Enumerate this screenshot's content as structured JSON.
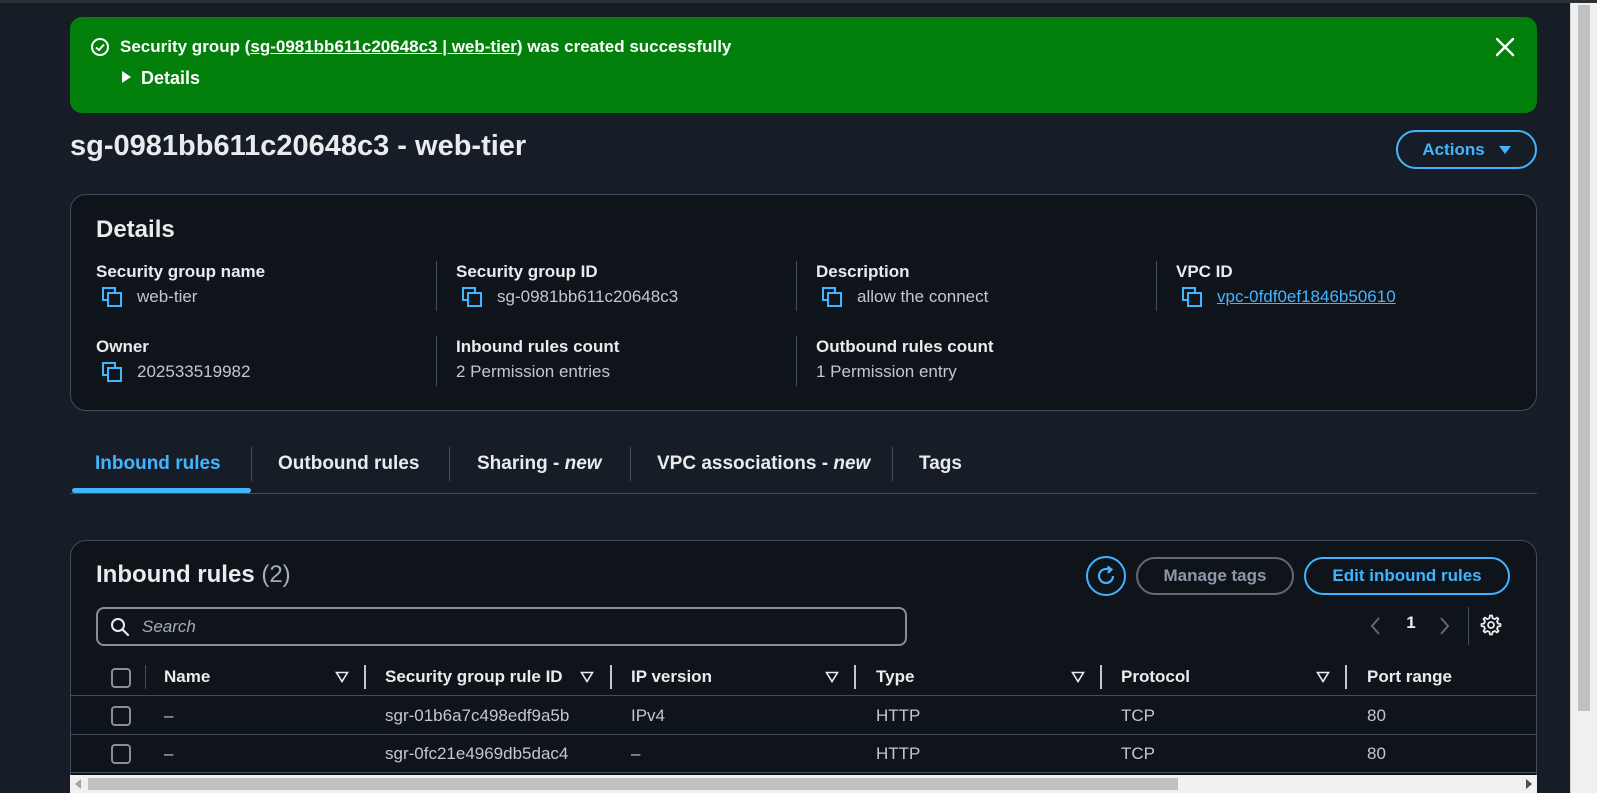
{
  "flash": {
    "message_prefix": "Security group (",
    "link_text": "sg-0981bb611c20648c3 | web-tier",
    "message_suffix": ") was created successfully",
    "details_label": "Details"
  },
  "page": {
    "title": "sg-0981bb611c20648c3 - web-tier",
    "actions_label": "Actions"
  },
  "details": {
    "title": "Details",
    "fields": [
      {
        "label": "Security group name",
        "value": "web-tier"
      },
      {
        "label": "Security group ID",
        "value": "sg-0981bb611c20648c3"
      },
      {
        "label": "Description",
        "value": "allow the connect"
      },
      {
        "label": "VPC ID",
        "value": "vpc-0fdf0ef1846b50610"
      },
      {
        "label": "Owner",
        "value": "202533519982"
      },
      {
        "label": "Inbound rules count",
        "value": "2 Permission entries"
      },
      {
        "label": "Outbound rules count",
        "value": "1 Permission entry"
      }
    ]
  },
  "tabs": [
    {
      "label": "Inbound rules",
      "suffix": ""
    },
    {
      "label": "Outbound rules",
      "suffix": ""
    },
    {
      "label": "Sharing - ",
      "suffix": "new"
    },
    {
      "label": "VPC associations - ",
      "suffix": "new"
    },
    {
      "label": "Tags",
      "suffix": ""
    }
  ],
  "rules": {
    "title": "Inbound rules",
    "count": "(2)",
    "manage_tags_label": "Manage tags",
    "edit_label": "Edit inbound rules",
    "search_placeholder": "Search",
    "page_number": "1",
    "columns": [
      "Name",
      "Security group rule ID",
      "IP version",
      "Type",
      "Protocol",
      "Port range"
    ],
    "rows": [
      {
        "name": "–",
        "rule_id": "sgr-01b6a7c498edf9a5b",
        "ip_version": "IPv4",
        "type": "HTTP",
        "protocol": "TCP",
        "port": "80"
      },
      {
        "name": "–",
        "rule_id": "sgr-0fc21e4969db5dac4",
        "ip_version": "–",
        "type": "HTTP",
        "protocol": "TCP",
        "port": "80"
      }
    ]
  },
  "colors": {
    "success": "#037f0c",
    "accent": "#42b4ff",
    "background": "#161d26",
    "card": "#0f141a"
  }
}
